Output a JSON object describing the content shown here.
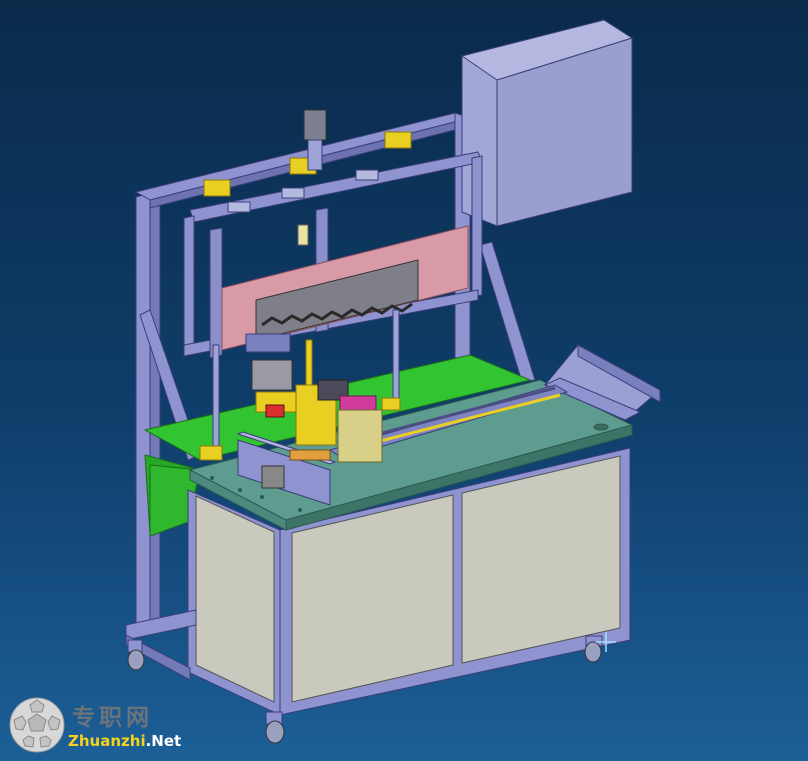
{
  "viewport": {
    "background_top": "#0a2a4a",
    "background_bottom": "#1c5f97"
  },
  "model": {
    "colors": {
      "frame": "#8f93cf",
      "frame_dark": "#6d72b0",
      "cabinet_panel": "#c9c9bd",
      "table_top": "#5e9c8f",
      "green_tray": "#33c432",
      "control_box": "#9a9fd0",
      "brush_panel": "#d99aa8",
      "yellow_parts": "#e8cf22",
      "magenta_part": "#d03b9c"
    }
  },
  "watermark": {
    "cn_text": "专职网",
    "en_part1": "Zhuanzhi",
    "en_part2": ".Net"
  }
}
